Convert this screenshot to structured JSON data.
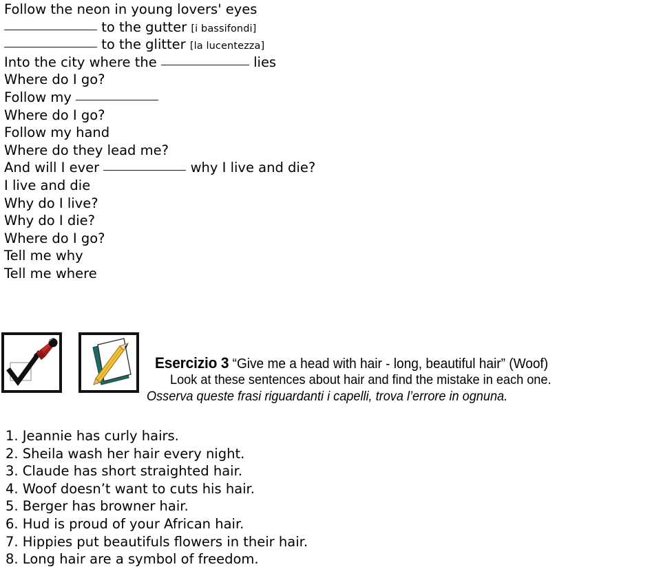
{
  "document": {
    "type": "worksheet-page",
    "background_color": "#ffffff",
    "text_color": "#000000"
  },
  "lyrics": {
    "name": "song-lyrics-fill-in-the-blanks",
    "lines": [
      {
        "id": 1,
        "text": "Follow the neon in young lovers' eyes",
        "blank_before": false
      },
      {
        "id": 2,
        "prefix": "",
        "blank": "wide",
        "text": " to the gutter ",
        "gloss": "[i bassifondi]"
      },
      {
        "id": 3,
        "prefix": "",
        "blank": "wide",
        "text": " to the glitter ",
        "gloss": "[la lucentezza]"
      },
      {
        "id": 4,
        "prefix": "Into the city where the ",
        "blank": "mid",
        "text": " lies"
      },
      {
        "id": 5,
        "text": "Where do I go?"
      },
      {
        "id": 6,
        "prefix": "Follow my ",
        "blank": "narrow",
        "text": ""
      },
      {
        "id": 7,
        "text": "Where do I go?"
      },
      {
        "id": 8,
        "text": "Follow my hand"
      },
      {
        "id": 9,
        "text": "Where do they lead me?"
      },
      {
        "id": 10,
        "prefix": "And will I ever ",
        "blank": "narrow",
        "text": " why I live and die?"
      },
      {
        "id": 11,
        "text": "I live and die"
      },
      {
        "id": 12,
        "text": "Why do I live?"
      },
      {
        "id": 13,
        "text": "Why do I die?"
      },
      {
        "id": 14,
        "text": "Where do I go?"
      },
      {
        "id": 15,
        "text": "Tell me why"
      },
      {
        "id": 16,
        "text": "Tell me where"
      }
    ],
    "line_1": "Follow the neon in young lovers' eyes",
    "line_2_suffix": " to the gutter ",
    "line_2_gloss": "[i bassifondi]",
    "line_3_suffix": " to the glitter ",
    "line_3_gloss": "[la lucentezza]",
    "line_4_prefix": "Into the city where the ",
    "line_4_suffix": " lies",
    "line_5": "Where do I go?",
    "line_6_prefix": "Follow my ",
    "line_7": "Where do I go?",
    "line_8": "Follow my hand",
    "line_9": "Where do they lead me?",
    "line_10_prefix": "And will I ever ",
    "line_10_suffix": " why I live and die?",
    "line_11": "I live and die",
    "line_12": "Why do I live?",
    "line_13": "Why do I die?",
    "line_14": "Where do I go?",
    "line_15": "Tell me why",
    "line_16": "Tell me where"
  },
  "icons": [
    {
      "name": "check-and-red-pen-icon",
      "description": "black checkmark in a grey square with a red marker pen",
      "colors": {
        "pen": "#9E1B1B",
        "pen_light": "#C42B2B",
        "check": "#101010",
        "box": "#b0b0b0",
        "border": "#121212"
      }
    },
    {
      "name": "pencil-and-notebook-icon",
      "description": "yellow pencil lying on a teal notebook with white pages",
      "colors": {
        "book": "#1F6B63",
        "pencil": "#F3C33C",
        "pencil_dark": "#D9A520",
        "page": "#ffffff",
        "border": "#121212"
      }
    }
  ],
  "exercise": {
    "number_label": "Esercizio 3",
    "quote": " “Give me a head with hair - long, beautiful hair” (Woof)",
    "instruction_en": "Look at these sentences about hair and find the mistake in each one.",
    "instruction_it": "Osserva queste frasi riguardanti i capelli, trova l’errore in ognuna."
  },
  "sentences": {
    "name": "numbered-sentence-list",
    "items": [
      {
        "num": "1.",
        "text": " Jeannie has curly hairs."
      },
      {
        "num": "2.",
        "text": " Sheila wash her hair every night."
      },
      {
        "num": "3.",
        "text": " Claude has short straighted hair."
      },
      {
        "num": "4.",
        "text": " Woof doesn’t want to cuts his hair."
      },
      {
        "num": "5.",
        "text": " Berger has browner hair."
      },
      {
        "num": "6.",
        "text": " Hud is proud of your African hair."
      },
      {
        "num": "7.",
        "text": " Hippies put beautifuls flowers in their hair."
      },
      {
        "num": "8.",
        "text": " Long hair are a symbol of freedom."
      }
    ],
    "item_1_num": "1.",
    "item_1_text": " Jeannie has curly hairs.",
    "item_2_num": "2.",
    "item_2_text": " Sheila wash her hair every night.",
    "item_3_num": "3.",
    "item_3_text": " Claude has short straighted hair.",
    "item_4_num": "4.",
    "item_4_text": " Woof doesn’t want to cuts his hair.",
    "item_5_num": "5.",
    "item_5_text": " Berger has browner hair.",
    "item_6_num": "6.",
    "item_6_text": " Hud is proud of your African hair.",
    "item_7_num": "7.",
    "item_7_text": " Hippies put beautifuls flowers in their hair.",
    "item_8_num": "8.",
    "item_8_text": " Long hair are a symbol of freedom."
  }
}
